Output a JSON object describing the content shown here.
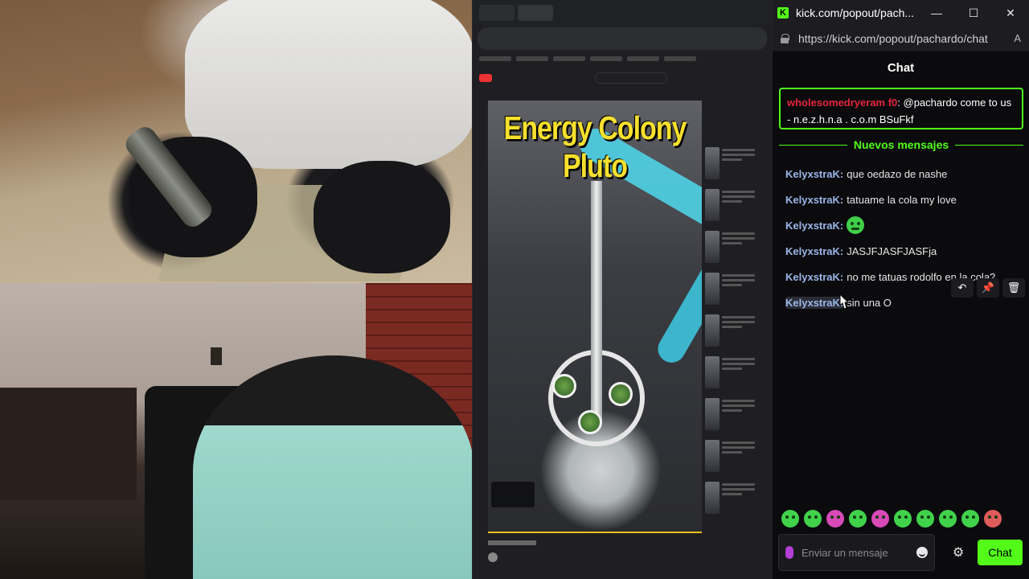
{
  "window": {
    "title": "kick.com/popout/pach...",
    "minimize": "—",
    "maximize": "☐",
    "close": "✕"
  },
  "address_bar": {
    "url": "https://kick.com/popout/pachardo/chat",
    "reader_icon": "A"
  },
  "chat": {
    "header": "Chat",
    "pinned": {
      "username": "wholesomedryeram f0",
      "text": ": @pachardo come to us - n.e.z.h.n.a . c.o.m BSuFkf"
    },
    "new_messages_label": "Nuevos mensajes",
    "messages": [
      {
        "user": "KelyxstraK:",
        "text": "que oedazo de nashe"
      },
      {
        "user": "KelyxstraK:",
        "text": "tatuame la cola my love"
      },
      {
        "user": "KelyxstraK:",
        "text": "",
        "emote": "green-emote"
      },
      {
        "user": "KelyxstraK:",
        "text": "JASJFJASFJASFja"
      },
      {
        "user": "KelyxstraK:",
        "text": "no me tatuas rodolfo en la cola?"
      },
      {
        "user": "KelyxstraK:",
        "text": "sin una O"
      }
    ],
    "message_actions": [
      "↶",
      "📌",
      "🗑"
    ],
    "input_placeholder": "Enviar un mensaje",
    "send_label": "Chat",
    "settings_icon": "⚙"
  },
  "video": {
    "title": "Energy Colony Pluto"
  },
  "colors": {
    "kick_green": "#53fc18",
    "username_blue": "#9bb6ea",
    "pinned_user_red": "#e3243a"
  }
}
